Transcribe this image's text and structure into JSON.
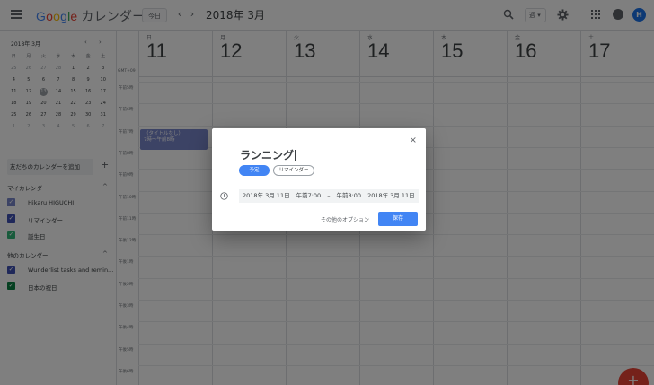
{
  "header": {
    "logo_google": [
      "G",
      "o",
      "o",
      "g",
      "l",
      "e"
    ],
    "app_name": "カレンダー",
    "today_label": "今日",
    "prev_label": "‹",
    "next_label": "›",
    "period": "2018年 3月",
    "view_select": "週 ▾",
    "avatar_letter": "H"
  },
  "mini_calendar": {
    "title": "2018年 3月",
    "prev": "‹",
    "next": "›",
    "weekdays": [
      "日",
      "月",
      "火",
      "水",
      "木",
      "金",
      "土"
    ],
    "weeks": [
      [
        "25",
        "26",
        "27",
        "28",
        "1",
        "2",
        "3"
      ],
      [
        "4",
        "5",
        "6",
        "7",
        "8",
        "9",
        "10"
      ],
      [
        "11",
        "12",
        "13",
        "14",
        "15",
        "16",
        "17"
      ],
      [
        "18",
        "19",
        "20",
        "21",
        "22",
        "23",
        "24"
      ],
      [
        "25",
        "26",
        "27",
        "28",
        "29",
        "30",
        "31"
      ],
      [
        "1",
        "2",
        "3",
        "4",
        "5",
        "6",
        "7"
      ]
    ],
    "today": "13"
  },
  "sidebar": {
    "add_friends": "友だちのカレンダーを追加",
    "add_plus": "+",
    "my_calendars_title": "マイカレンダー",
    "my_calendars": [
      {
        "label": "Hikaru HIGUCHI",
        "color": "#7986cb"
      },
      {
        "label": "リマインダー",
        "color": "#3f51b5"
      },
      {
        "label": "誕生日",
        "color": "#33b679"
      }
    ],
    "other_calendars_title": "他のカレンダー",
    "other_calendars": [
      {
        "label": "Wunderlist tasks and remin...",
        "color": "#3f51b5"
      },
      {
        "label": "日本の祝日",
        "color": "#0b8043"
      }
    ],
    "caret": "^"
  },
  "week": {
    "timezone": "GMT+09",
    "days": [
      {
        "name": "日",
        "num": "11"
      },
      {
        "name": "月",
        "num": "12"
      },
      {
        "name": "火",
        "num": "13"
      },
      {
        "name": "水",
        "num": "14"
      },
      {
        "name": "木",
        "num": "15"
      },
      {
        "name": "金",
        "num": "16"
      },
      {
        "name": "土",
        "num": "17"
      }
    ],
    "hours": [
      "午前5時",
      "午前6時",
      "午前7時",
      "午前8時",
      "午前9時",
      "午前10時",
      "午前11時",
      "午後12時",
      "午後1時",
      "午後2時",
      "午後3時",
      "午後4時",
      "午後5時",
      "午後6時"
    ],
    "event": {
      "title": "（タイトルなし）",
      "time": "7時～午前8時"
    }
  },
  "dialog": {
    "title_value": "ランニング",
    "chip_event": "予定",
    "chip_reminder": "リマインダー",
    "start_date": "2018年 3月 11日",
    "start_time": "午前7:00",
    "dash": "–",
    "end_time": "午前8:00",
    "end_date": "2018年 3月 11日",
    "more_options": "その他のオプション",
    "save": "保存",
    "close": "×"
  },
  "fab_label": "+"
}
